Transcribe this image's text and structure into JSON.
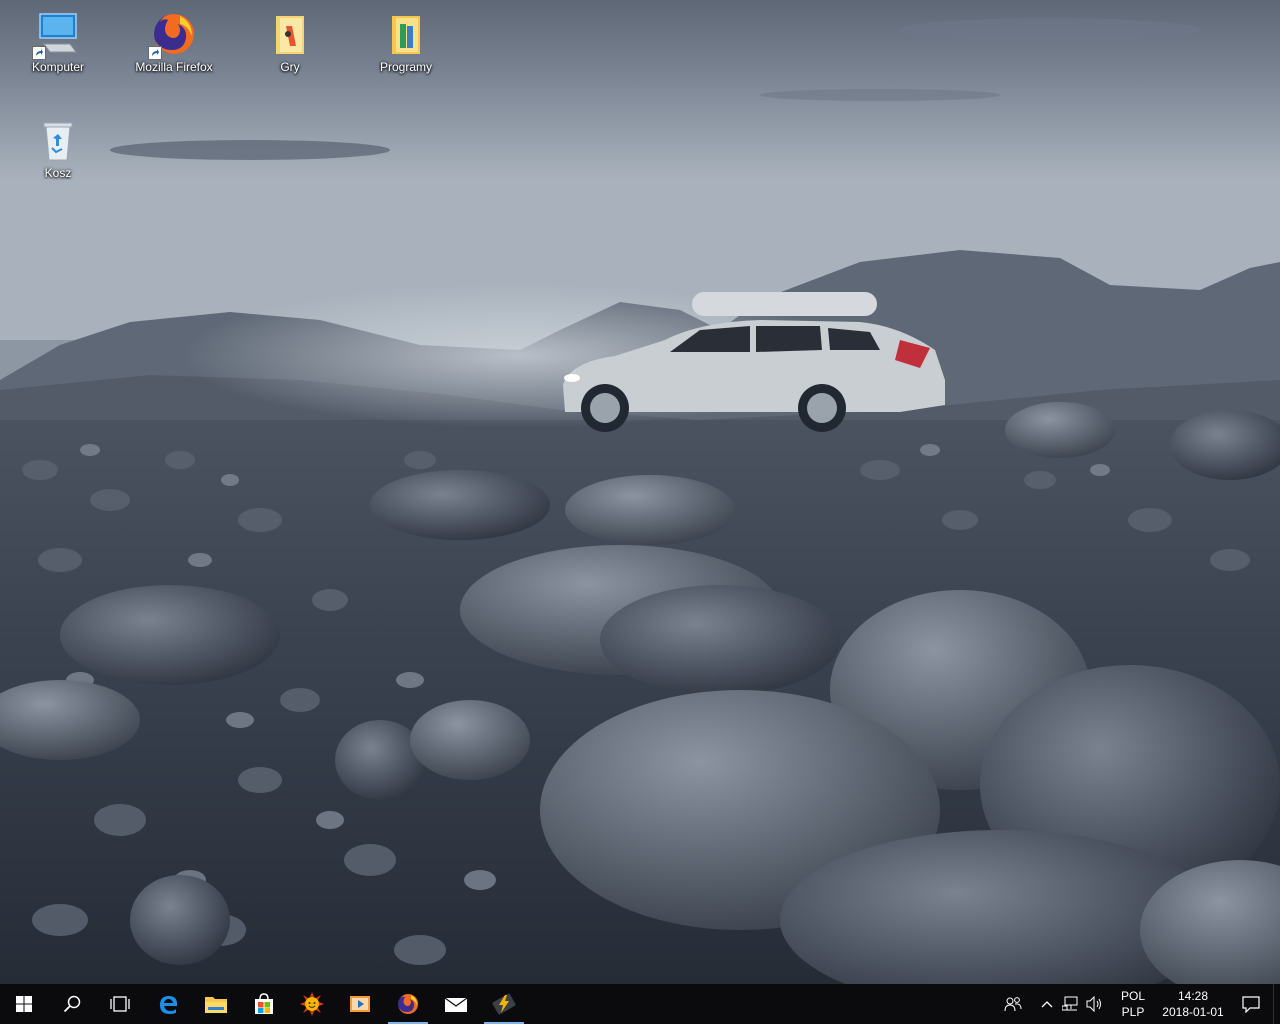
{
  "desktop_icons": {
    "komputer": "Komputer",
    "firefox": "Mozilla Firefox",
    "gry": "Gry",
    "programy": "Programy",
    "kosz": "Kosz"
  },
  "taskbar": {
    "pinned": [
      "start-icon",
      "search-icon",
      "task-view-icon",
      "edge-icon",
      "file-explorer-icon",
      "store-icon",
      "weather-app-icon",
      "media-player-icon",
      "firefox-icon",
      "mail-icon",
      "app-launcher-icon"
    ],
    "accent_color": "#7eb4ea"
  },
  "tray": {
    "lang_top": "POL",
    "lang_bottom": "PLP",
    "time": "14:28",
    "date": "2018-01-01"
  }
}
